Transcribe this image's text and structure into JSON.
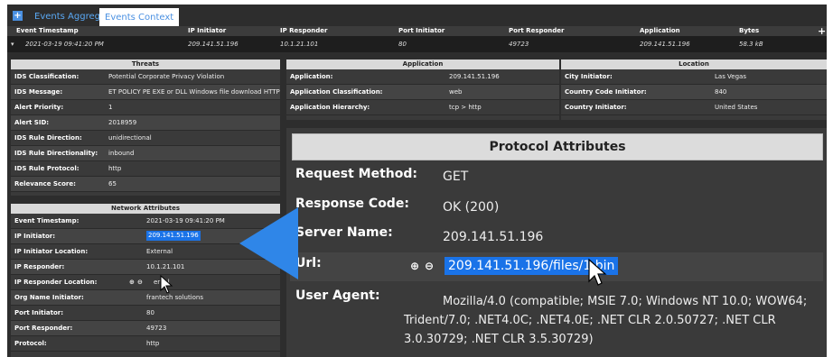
{
  "tabs": {
    "events_aggregation": "Events Aggregation",
    "events_context": "Events Context"
  },
  "table": {
    "headers": [
      "Event Timestamp",
      "IP Initiator",
      "IP Responder",
      "Port Initiator",
      "Port Responder",
      "Application",
      "Bytes"
    ],
    "row": [
      "2021-03-19 09:41:20 PM",
      "209.141.51.196",
      "10.1.21.101",
      "80",
      "49723",
      "209.141.51.196",
      "58.3 kB"
    ]
  },
  "threats": {
    "title": "Threats",
    "rows": [
      {
        "k": "IDS Classification:",
        "v": "Potential Corporate Privacy Violation"
      },
      {
        "k": "IDS Message:",
        "v": "ET POLICY PE EXE or DLL Windows file download HTTP"
      },
      {
        "k": "Alert Priority:",
        "v": "1"
      },
      {
        "k": "Alert SID:",
        "v": "2018959"
      },
      {
        "k": "IDS Rule Direction:",
        "v": "unidirectional"
      },
      {
        "k": "IDS Rule Directionality:",
        "v": "inbound"
      },
      {
        "k": "IDS Rule Protocol:",
        "v": "http"
      },
      {
        "k": "Relevance Score:",
        "v": "65"
      }
    ]
  },
  "application": {
    "title": "Application",
    "rows": [
      {
        "k": "Application:",
        "v": "209.141.51.196"
      },
      {
        "k": "Application Classification:",
        "v": "web"
      },
      {
        "k": "Application Hierarchy:",
        "v": "tcp > http"
      }
    ]
  },
  "location": {
    "title": "Location",
    "rows": [
      {
        "k": "City Initiator:",
        "v": "Las Vegas"
      },
      {
        "k": "Country Code Initiator:",
        "v": "840"
      },
      {
        "k": "Country Initiator:",
        "v": "United States"
      }
    ]
  },
  "network": {
    "title": "Network Attributes",
    "rows": [
      {
        "k": "Event Timestamp:",
        "v": "2021-03-19 09:41:20 PM"
      },
      {
        "k": "IP Initiator:",
        "v": "209.141.51.196"
      },
      {
        "k": "IP Initiator Location:",
        "v": "External"
      },
      {
        "k": "IP Responder:",
        "v": "10.1.21.101"
      },
      {
        "k": "IP Responder Location:",
        "v": "ernal"
      },
      {
        "k": "Org Name Initiator:",
        "v": "frantech solutions"
      },
      {
        "k": "Port Initiator:",
        "v": "80"
      },
      {
        "k": "Port Responder:",
        "v": "49723"
      },
      {
        "k": "Protocol:",
        "v": "http"
      }
    ]
  },
  "protocol": {
    "title": "Protocol Attributes",
    "request_method_label": "Request Method:",
    "request_method": "GET",
    "response_code_label": "Response Code:",
    "response_code": "OK (200)",
    "server_name_label": "Server Name:",
    "server_name": "209.141.51.196",
    "url_label": "Url:",
    "url": "209.141.51.196/files/1.bin",
    "user_agent_label": "User Agent:",
    "user_agent": "Mozilla/4.0 (compatible; MSIE 7.0; Windows NT 10.0; WOW64; Trident/7.0; .NET4.0C; .NET4.0E; .NET CLR 2.0.50727; .NET CLR 3.0.30729; .NET CLR 3.5.30729)"
  },
  "colors": {
    "accent": "#2f86e8",
    "highlight": "#1a73e8",
    "panel": "#3a3a3a"
  }
}
